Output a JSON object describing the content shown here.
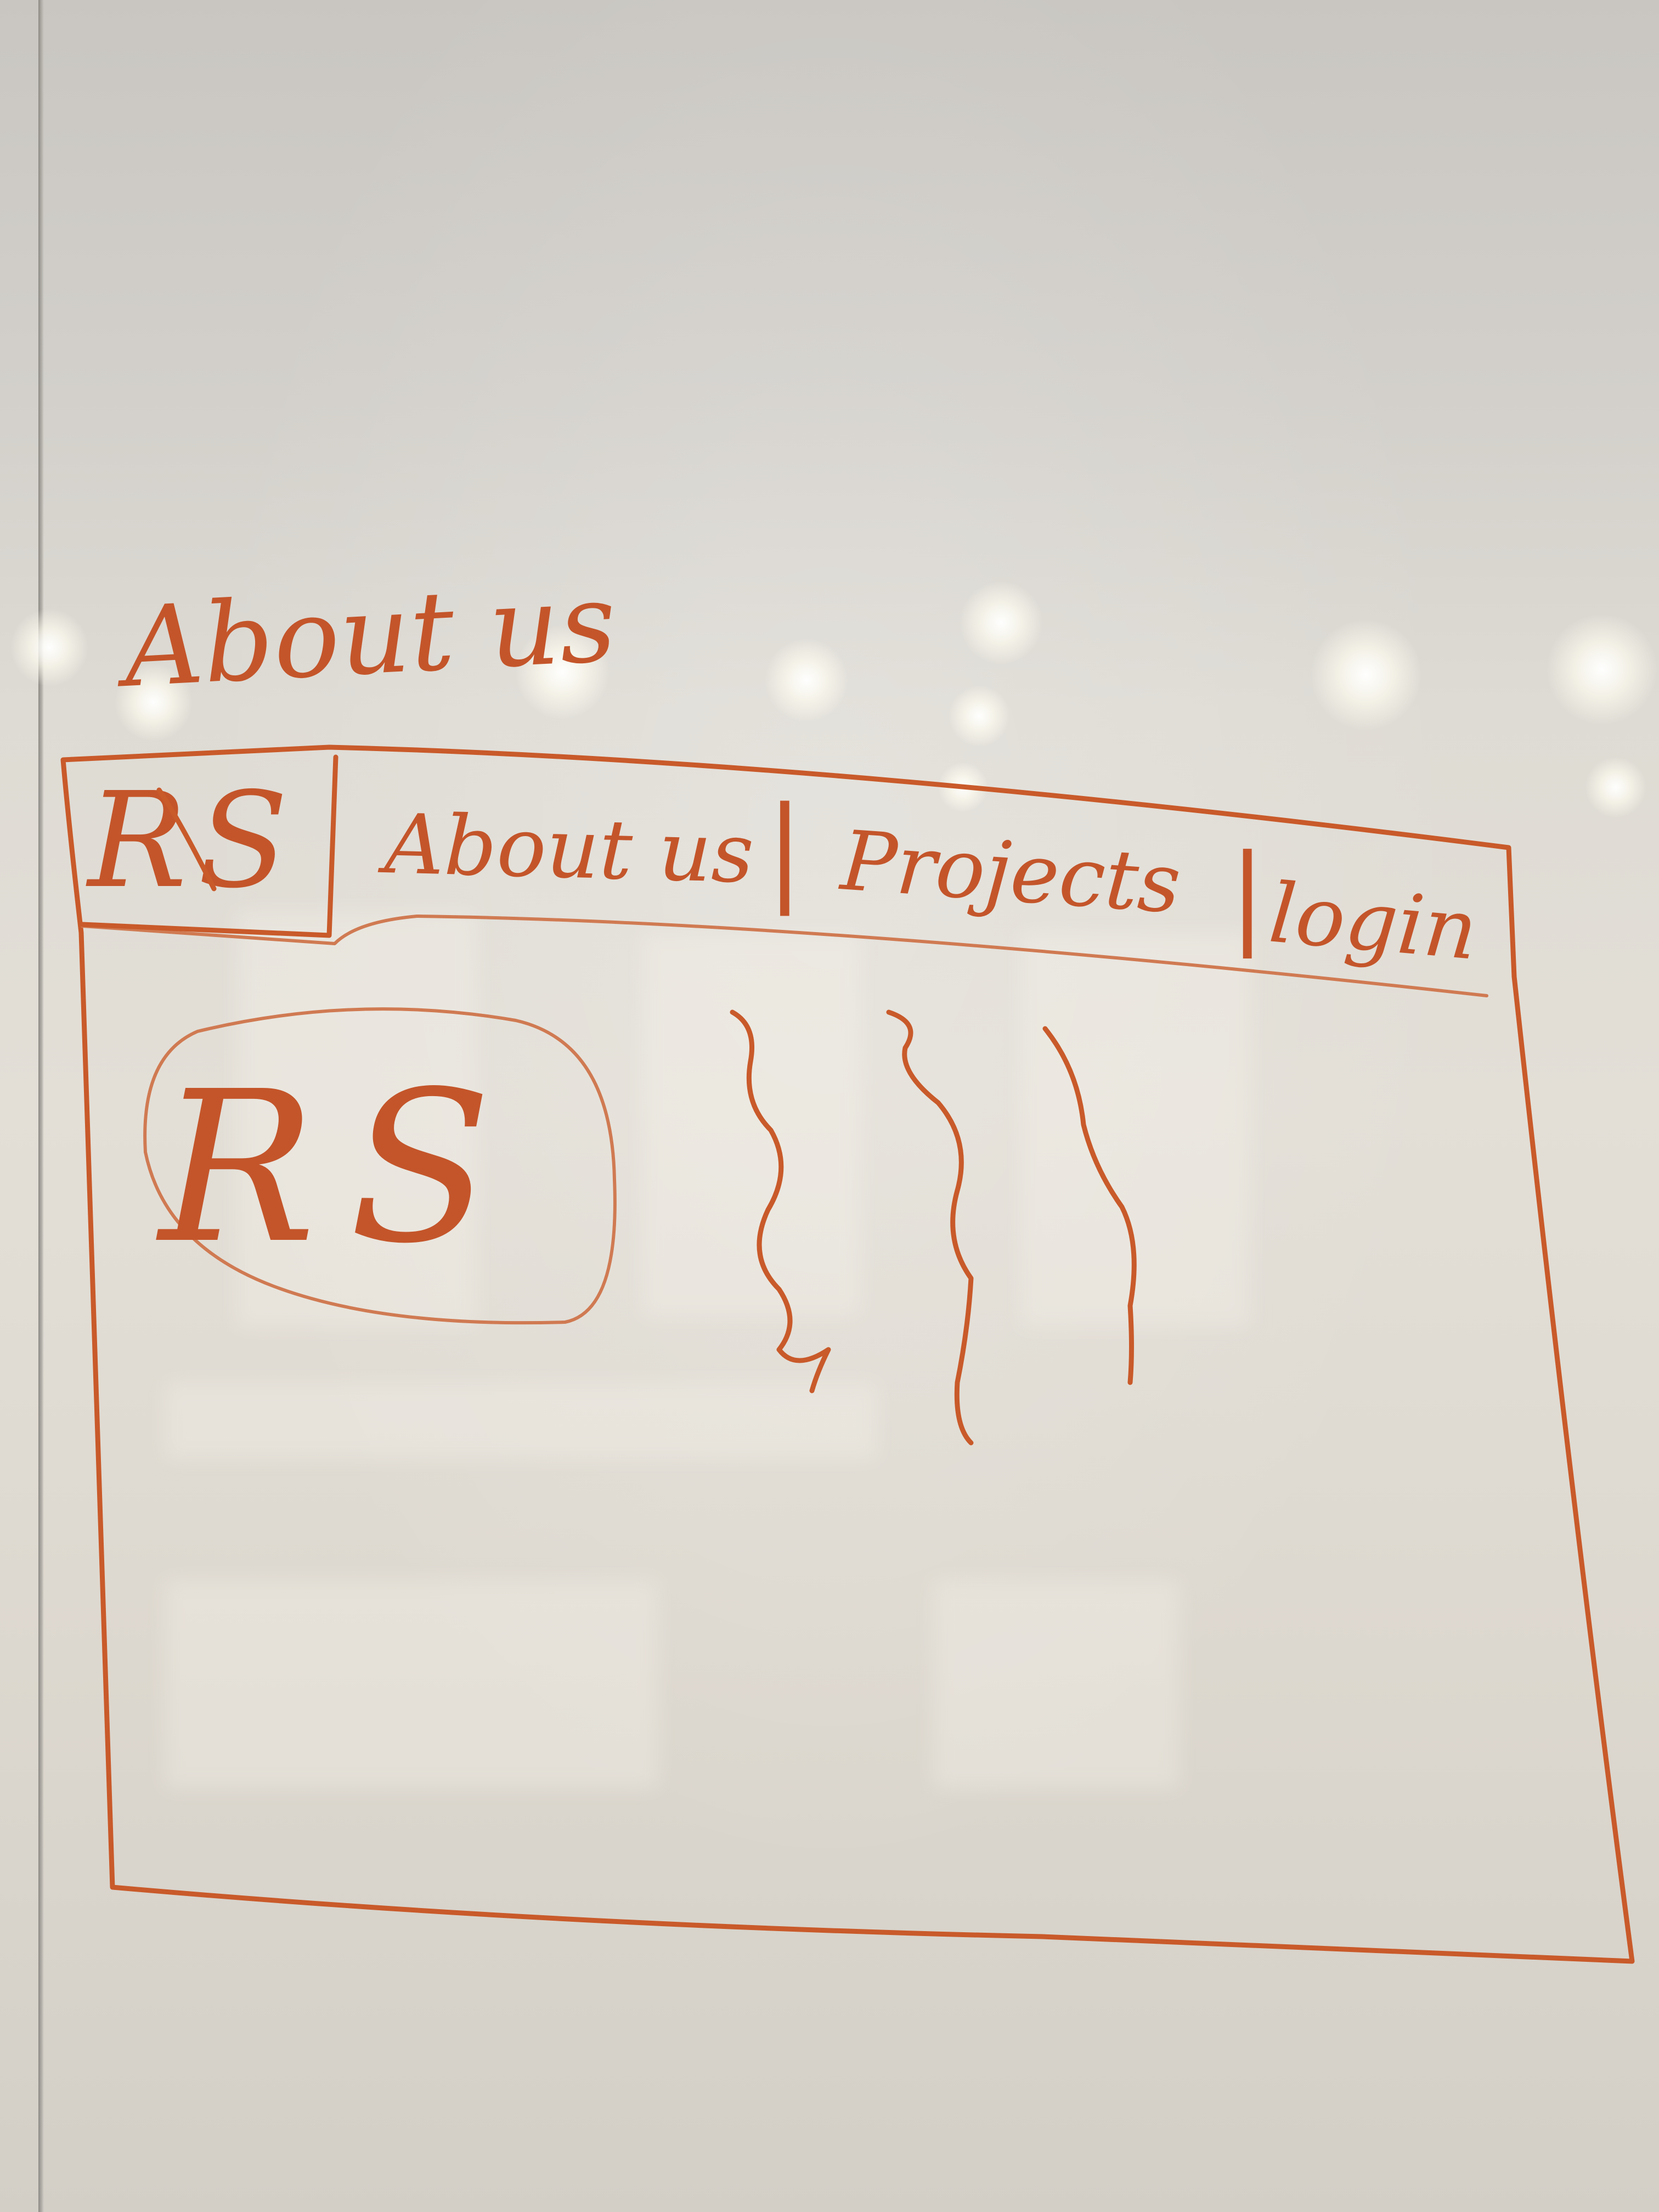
{
  "ink_color": "#c95a2a",
  "board_color": "#e3dfd7",
  "page_heading": "About us",
  "navbar": {
    "logo_text": "RS",
    "items": [
      "About us",
      "Projects",
      "login"
    ],
    "separator": "|"
  },
  "content": {
    "logo_text": "RS"
  }
}
